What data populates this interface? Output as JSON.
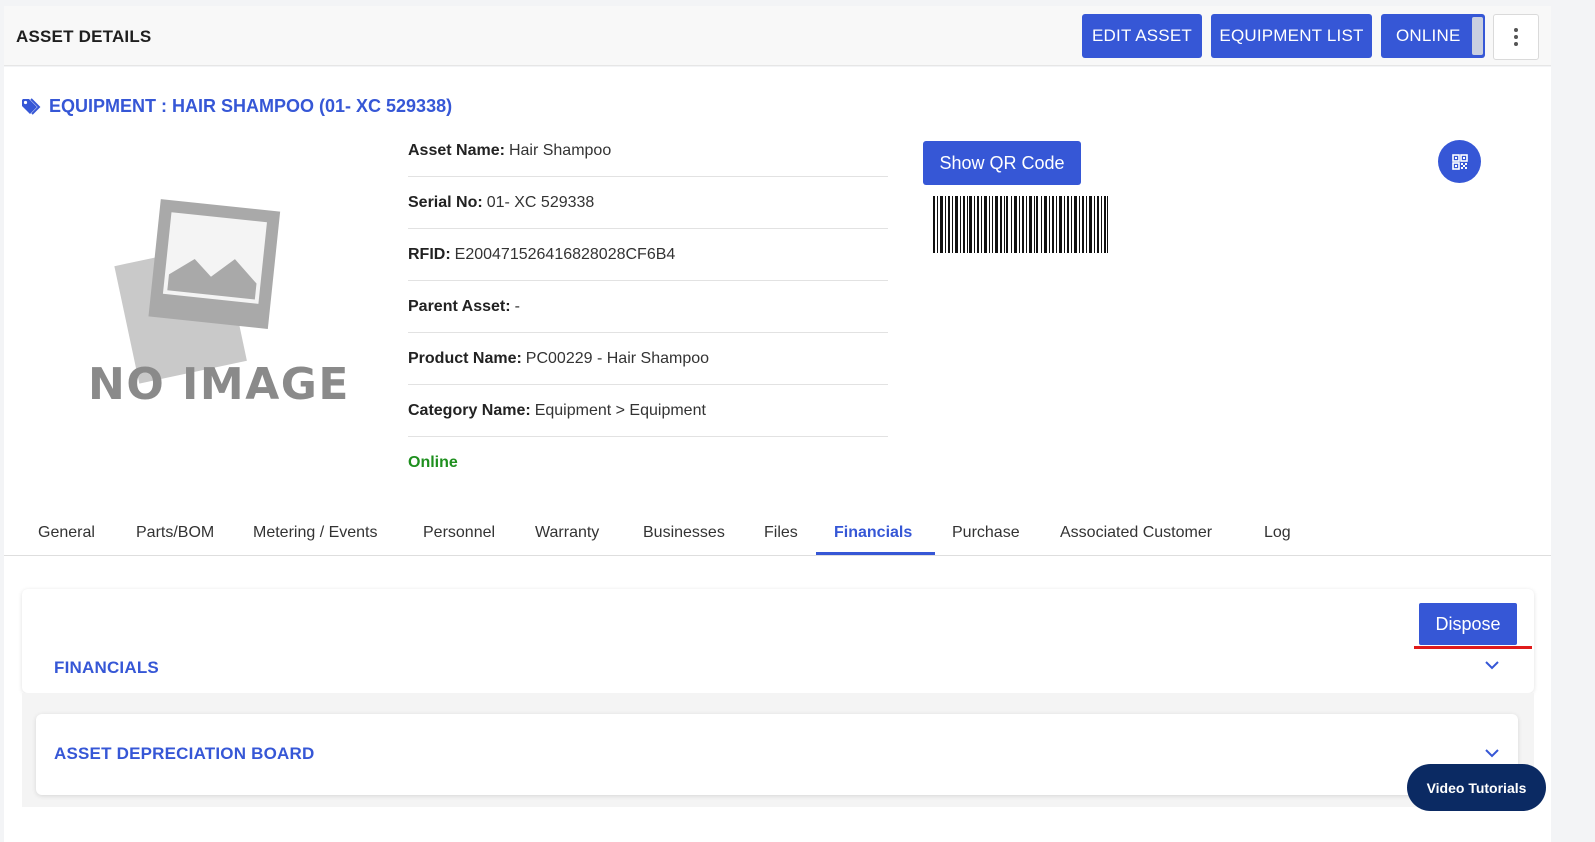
{
  "header": {
    "title": "ASSET DETAILS",
    "edit_label": "EDIT ASSET",
    "equipment_list_label": "EQUIPMENT LIST",
    "online_label": "ONLINE"
  },
  "equipment": {
    "title": "EQUIPMENT : HAIR SHAMPOO (01- XC 529338)",
    "no_image_text": "NO IMAGE"
  },
  "details": {
    "asset_name_label": "Asset Name:",
    "asset_name": "Hair Shampoo",
    "serial_label": "Serial No:",
    "serial": "01- XC 529338",
    "rfid_label": "RFID:",
    "rfid": "E200471526416828028CF6B4",
    "parent_label": "Parent Asset:",
    "parent": "-",
    "product_label": "Product Name:",
    "product": "PC00229 - Hair Shampoo",
    "category_label": "Category Name:",
    "category": "Equipment > Equipment",
    "status": "Online"
  },
  "qr": {
    "button_label": "Show QR Code"
  },
  "tabs": [
    {
      "label": "General"
    },
    {
      "label": "Parts/BOM"
    },
    {
      "label": "Metering / Events"
    },
    {
      "label": "Personnel"
    },
    {
      "label": "Warranty"
    },
    {
      "label": "Businesses"
    },
    {
      "label": "Files"
    },
    {
      "label": "Financials",
      "active": true
    },
    {
      "label": "Purchase"
    },
    {
      "label": "Associated Customer"
    },
    {
      "label": "Log"
    }
  ],
  "financials": {
    "dispose_label": "Dispose",
    "section_title": "FINANCIALS",
    "depreciation_title": "ASSET DEPRECIATION BOARD"
  },
  "video": {
    "label": "Video Tutorials"
  },
  "colors": {
    "accent": "#3657d6",
    "online_green": "#1e8f1e",
    "highlight_red": "#e01b1b",
    "video_navy": "#0b2a63"
  }
}
